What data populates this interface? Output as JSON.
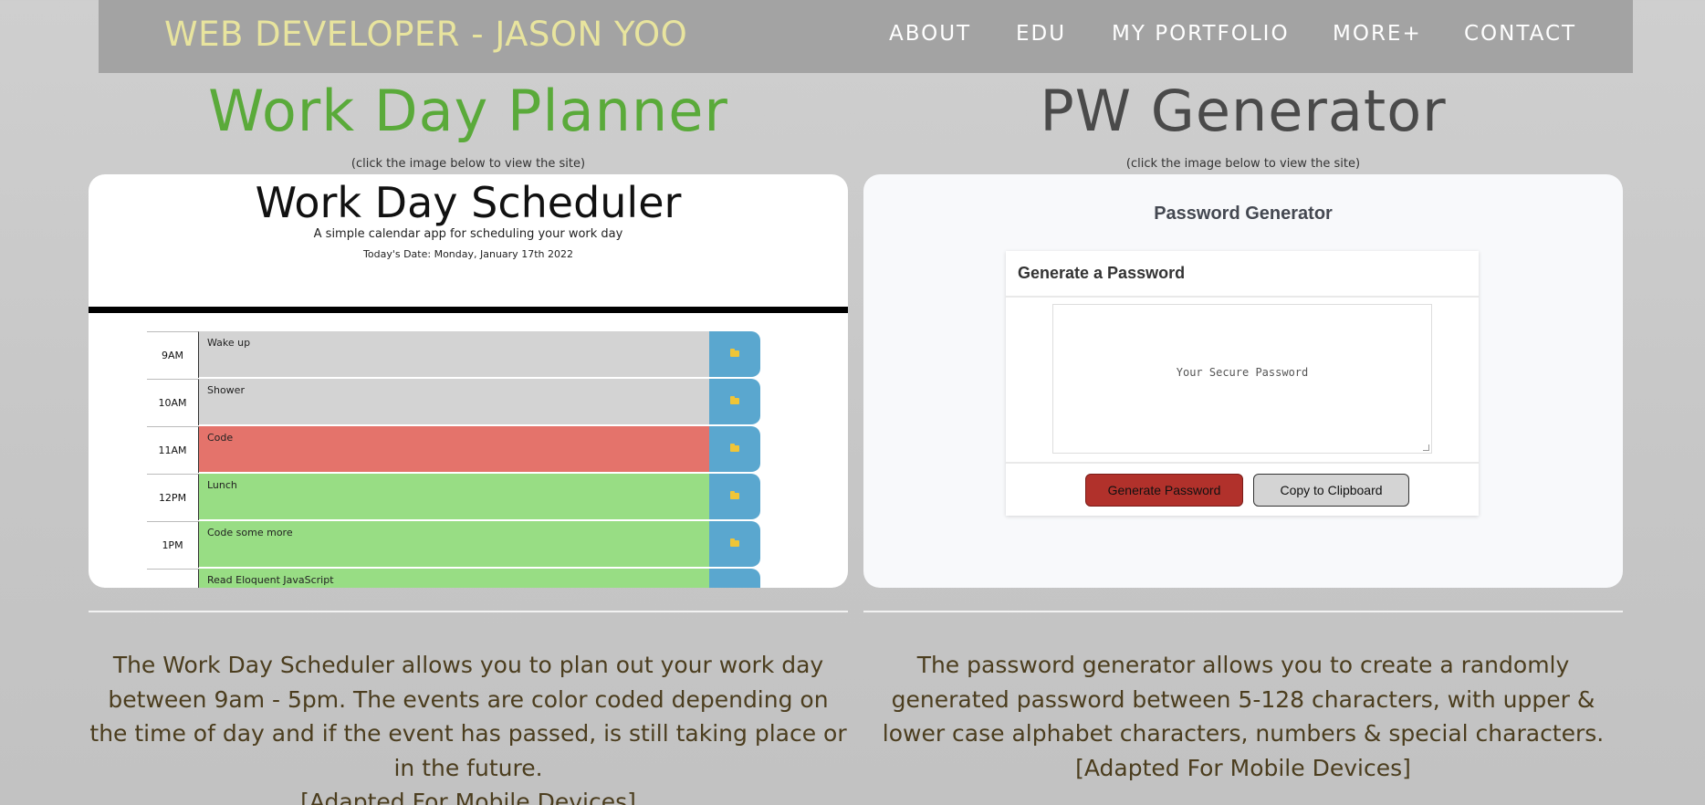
{
  "nav": {
    "brand": "WEB DEVELOPER - JASON YOO",
    "items": [
      "ABOUT",
      "EDU",
      "MY PORTFOLIO",
      "MORE+",
      "CONTACT"
    ]
  },
  "projects": [
    {
      "title": "Work Day Planner",
      "hint": "(click the image below to view the site)",
      "description": "The Work Day Scheduler allows you to plan out your work day between 9am - 5pm. The events are color coded depending on the time of day and if the event has passed, is still taking place or in the future.",
      "mobile_note": "[Adapted For Mobile Devices]"
    },
    {
      "title": "PW Generator",
      "hint": "(click the image below to view the site)",
      "description": "The password generator allows you to create a randomly generated password between 5-128 characters, with upper & lower case alphabet characters, numbers & special characters.",
      "mobile_note": "[Adapted For Mobile Devices]"
    }
  ],
  "scheduler": {
    "title": "Work Day Scheduler",
    "subtitle": "A simple calendar app for scheduling your work day",
    "date": "Today's Date: Monday, January 17th 2022",
    "rows": [
      {
        "hour": "9AM",
        "event": "Wake up",
        "status": "past"
      },
      {
        "hour": "10AM",
        "event": "Shower",
        "status": "past"
      },
      {
        "hour": "11AM",
        "event": "Code",
        "status": "present"
      },
      {
        "hour": "12PM",
        "event": "Lunch",
        "status": "future"
      },
      {
        "hour": "1PM",
        "event": "Code some more",
        "status": "future"
      },
      {
        "hour": "",
        "event": "Read Eloquent JavaScript",
        "status": "future"
      }
    ]
  },
  "pwgen": {
    "heading": "Password Generator",
    "card_title": "Generate a Password",
    "placeholder": "Your Secure Password",
    "generate_label": "Generate Password",
    "copy_label": "Copy to Clipboard"
  },
  "colors": {
    "brand": "#e8e49e",
    "title_left": "#5aaa3a",
    "title_right": "#4a4a4a",
    "past": "#d3d3d3",
    "present": "#e4736b",
    "future": "#98dd84",
    "save": "#5aa7cf",
    "generate": "#b1312b"
  }
}
